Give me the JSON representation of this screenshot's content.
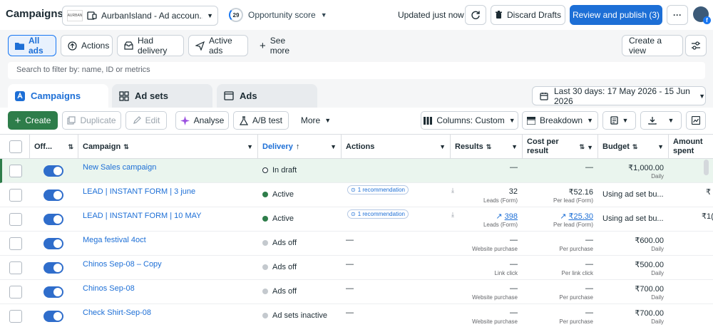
{
  "topbar": {
    "title": "Campaigns",
    "account_name": "AurbanIsland - Ad accoun...",
    "account_logo_text": "AURBAN",
    "opportunity_score": "29",
    "opportunity_label": "Opportunity score",
    "updated_text": "Updated just now",
    "discard_label": "Discard Drafts",
    "review_label": "Review and publish (3)",
    "more_label": "···"
  },
  "filters": {
    "chips": [
      "All ads",
      "Actions",
      "Had delivery",
      "Active ads",
      "See more"
    ],
    "create_view": "Create a view",
    "search_placeholder": "Search to filter by: name, ID or metrics"
  },
  "level_tabs": [
    "Campaigns",
    "Ad sets",
    "Ads"
  ],
  "date_range": "Last 30 days: 17 May 2026 - 15 Jun 2026",
  "toolbar": {
    "create": "Create",
    "duplicate": "Duplicate",
    "edit": "Edit",
    "analyse": "Analyse",
    "ab_test": "A/B test",
    "more": "More",
    "columns": "Columns: Custom",
    "breakdown": "Breakdown"
  },
  "columns": {
    "off_on": "Off...",
    "campaign": "Campaign",
    "delivery": "Delivery",
    "actions": "Actions",
    "results": "Results",
    "cost_per_result_1": "Cost per",
    "cost_per_result_2": "result",
    "budget": "Budget",
    "amount_spent_1": "Amount",
    "amount_spent_2": "spent"
  },
  "rows": [
    {
      "campaign": "New Sales campaign",
      "delivery": "In draft",
      "actions": "",
      "results": "—",
      "results_sub": "",
      "cost": "—",
      "cost_sub": "",
      "budget": "₹1,000.00",
      "budget_sub": "Daily",
      "amount": ""
    },
    {
      "campaign": "LEAD | INSTANT FORM | 3 june",
      "delivery": "Active",
      "actions": "1 recommendation",
      "results": "32",
      "results_sub": "Leads (Form)",
      "cost": "₹52.16",
      "cost_sub": "Per lead (Form)",
      "budget": "Using ad set bu...",
      "budget_sub": "",
      "amount": "₹"
    },
    {
      "campaign": "LEAD | INSTANT FORM | 10 MAY",
      "delivery": "Active",
      "actions": "1 recommendation",
      "results": "398",
      "results_sub": "Leads (Form)",
      "cost": "₹25.30",
      "cost_sub": "Per lead (Form)",
      "budget": "Using ad set bu...",
      "budget_sub": "",
      "amount": "₹1("
    },
    {
      "campaign": "Mega festival 4oct",
      "delivery": "Ads off",
      "actions": "—",
      "results": "—",
      "results_sub": "Website purchase",
      "cost": "—",
      "cost_sub": "Per purchase",
      "budget": "₹600.00",
      "budget_sub": "Daily",
      "amount": ""
    },
    {
      "campaign": "Chinos Sep-08 – Copy",
      "delivery": "Ads off",
      "actions": "—",
      "results": "—",
      "results_sub": "Link click",
      "cost": "—",
      "cost_sub": "Per link click",
      "budget": "₹500.00",
      "budget_sub": "Daily",
      "amount": ""
    },
    {
      "campaign": "Chinos Sep-08",
      "delivery": "Ads off",
      "actions": "—",
      "results": "—",
      "results_sub": "Website purchase",
      "cost": "—",
      "cost_sub": "Per purchase",
      "budget": "₹700.00",
      "budget_sub": "Daily",
      "amount": ""
    },
    {
      "campaign": "Check Shirt-Sep-08",
      "delivery": "Ad sets inactive",
      "actions": "—",
      "results": "—",
      "results_sub": "Website purchase",
      "cost": "—",
      "cost_sub": "Per purchase",
      "budget": "₹700.00",
      "budget_sub": "Daily",
      "amount": ""
    }
  ],
  "colors": {
    "accent": "#1d6fd6",
    "create_green": "#2e7d4a",
    "draft_row": "#eaf5ee"
  }
}
